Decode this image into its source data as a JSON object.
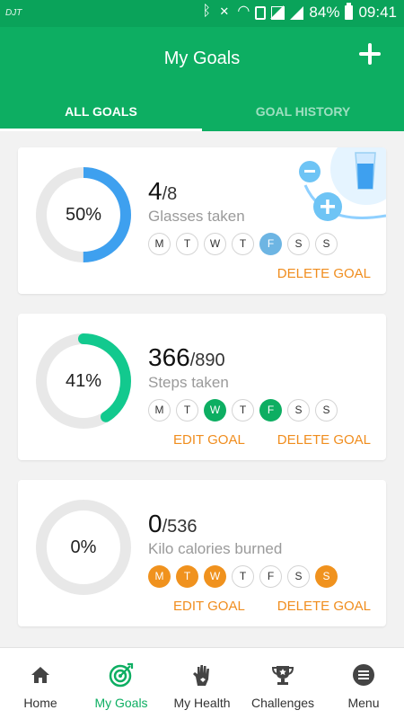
{
  "status": {
    "carrier": "DJT",
    "battery": "84%",
    "time": "09:41"
  },
  "header": {
    "title": "My Goals"
  },
  "tabs": [
    {
      "label": "ALL GOALS"
    },
    {
      "label": "GOAL HISTORY"
    }
  ],
  "colors": {
    "primary": "#0dae62",
    "accent": "#f08d1e",
    "water": "#3ea0ef",
    "steps": "#12c98e",
    "day_water": "#6db5e3",
    "day_steps": "#0dae62",
    "day_cal": "#f0921e"
  },
  "goals": [
    {
      "percent": "50%",
      "progress": 0.5,
      "current": "4",
      "target": "/8",
      "label": "Glasses taken",
      "days": [
        "M",
        "T",
        "W",
        "T",
        "F",
        "S",
        "S"
      ],
      "done_days": [
        4
      ],
      "edit": "",
      "delete": "DELETE GOAL"
    },
    {
      "percent": "41%",
      "progress": 0.41,
      "current": "366",
      "target": "/890",
      "label": "Steps taken",
      "days": [
        "M",
        "T",
        "W",
        "T",
        "F",
        "S",
        "S"
      ],
      "done_days": [
        2,
        4
      ],
      "edit": "EDIT GOAL",
      "delete": "DELETE GOAL"
    },
    {
      "percent": "0%",
      "progress": 0,
      "current": "0",
      "target": "/536",
      "label": "Kilo calories burned",
      "days": [
        "M",
        "T",
        "W",
        "T",
        "F",
        "S",
        "S"
      ],
      "done_days": [
        0,
        1,
        2,
        6
      ],
      "edit": "EDIT GOAL",
      "delete": "DELETE GOAL"
    }
  ],
  "nav": [
    {
      "label": "Home",
      "icon": "home-icon"
    },
    {
      "label": "My Goals",
      "icon": "target-icon"
    },
    {
      "label": "My Health",
      "icon": "hand-icon"
    },
    {
      "label": "Challenges",
      "icon": "trophy-icon"
    },
    {
      "label": "Menu",
      "icon": "menu-icon"
    }
  ]
}
